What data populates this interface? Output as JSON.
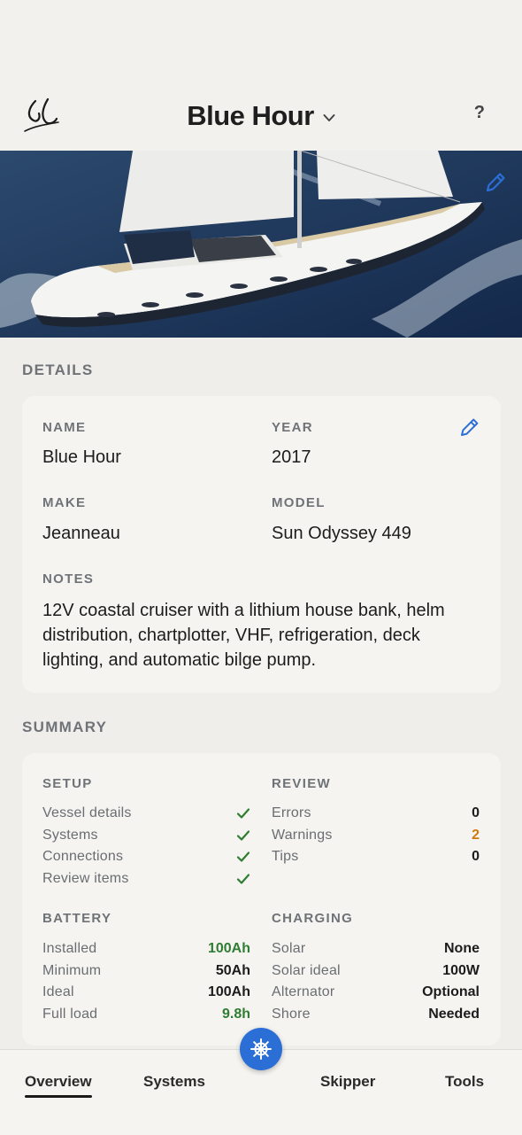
{
  "header": {
    "title": "Blue Hour",
    "help_label": "?"
  },
  "details": {
    "section_label": "DETAILS",
    "name_label": "NAME",
    "name_value": "Blue Hour",
    "year_label": "YEAR",
    "year_value": "2017",
    "make_label": "MAKE",
    "make_value": "Jeanneau",
    "model_label": "MODEL",
    "model_value": "Sun Odyssey 449",
    "notes_label": "NOTES",
    "notes_value": "12V coastal cruiser with a lithium house bank, helm distribution, chartplotter, VHF, refrigeration, deck lighting, and automatic bilge pump."
  },
  "summary": {
    "section_label": "SUMMARY",
    "setup": {
      "title": "SETUP",
      "items": [
        {
          "label": "Vessel details",
          "status": "check-icon"
        },
        {
          "label": "Systems",
          "status": "check-icon"
        },
        {
          "label": "Connections",
          "status": "check-icon"
        },
        {
          "label": "Review items",
          "status": "check-icon"
        }
      ]
    },
    "review": {
      "title": "REVIEW",
      "items": [
        {
          "label": "Errors",
          "value": "0"
        },
        {
          "label": "Warnings",
          "value": "2"
        },
        {
          "label": "Tips",
          "value": "0"
        }
      ]
    },
    "battery": {
      "title": "BATTERY",
      "items": [
        {
          "label": "Installed",
          "value": "100Ah"
        },
        {
          "label": "Minimum",
          "value": "50Ah"
        },
        {
          "label": "Ideal",
          "value": "100Ah"
        },
        {
          "label": "Full load",
          "value": "9.8h"
        }
      ]
    },
    "charging": {
      "title": "CHARGING",
      "items": [
        {
          "label": "Solar",
          "value": "None"
        },
        {
          "label": "Solar ideal",
          "value": "100W"
        },
        {
          "label": "Alternator",
          "value": "Optional"
        },
        {
          "label": "Shore",
          "value": "Needed"
        }
      ]
    }
  },
  "tabs": {
    "overview": "Overview",
    "systems": "Systems",
    "skipper": "Skipper",
    "tools": "Tools",
    "center_icon": "helm-wheel-icon"
  },
  "colors": {
    "accent": "#2b6fd6",
    "success": "#2f7d32",
    "warning": "#d07a0c",
    "background": "#efeeeb",
    "card": "#f5f4f1"
  }
}
